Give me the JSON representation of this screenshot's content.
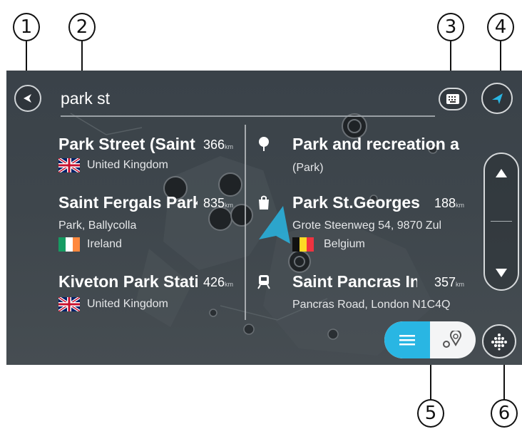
{
  "callouts": [
    "1",
    "2",
    "3",
    "4",
    "5",
    "6"
  ],
  "search": {
    "value": "park st"
  },
  "results_left": [
    {
      "name": "Park Street (Saint",
      "distance": "366",
      "unit": "km",
      "country": "United Kingdom",
      "flag": "uk-flag"
    },
    {
      "name": "Saint Fergals Park",
      "distance": "835",
      "unit": "km",
      "subtitle": "Park, Ballycolla",
      "country": "Ireland",
      "flag": "ireland-flag"
    },
    {
      "name": "Kiveton Park Stati",
      "distance": "426",
      "unit": "km",
      "country": "United Kingdom",
      "flag": "uk-flag"
    }
  ],
  "results_right": [
    {
      "icon": "park-icon",
      "name": "Park and recreation a",
      "subtitle": "(Park)"
    },
    {
      "icon": "shopping-bag-icon",
      "name": "Park St.Georges",
      "distance": "188",
      "unit": "km",
      "subtitle": "Grote Steenweg 54, 9870 Zul",
      "country": "Belgium",
      "flag": "belgium-flag"
    },
    {
      "icon": "train-icon",
      "name": "Saint Pancras Int",
      "distance": "357",
      "unit": "km",
      "subtitle": "Pancras Road, London N1C4Q"
    }
  ],
  "colors": {
    "accent": "#29b6e3",
    "ireland_green": "#169b62",
    "ireland_orange": "#ff883e",
    "belgium_red": "#ef3340",
    "belgium_yellow": "#fdda24"
  },
  "icons": {
    "back": "back-arrow-icon",
    "keyboard": "keyboard-map-icon",
    "navigate": "navigation-arrow-icon",
    "scroll_up": "chevron-up-icon",
    "scroll_down": "chevron-down-icon",
    "list_view": "list-icon",
    "map_view": "map-pins-icon",
    "menu": "main-menu-icon"
  }
}
